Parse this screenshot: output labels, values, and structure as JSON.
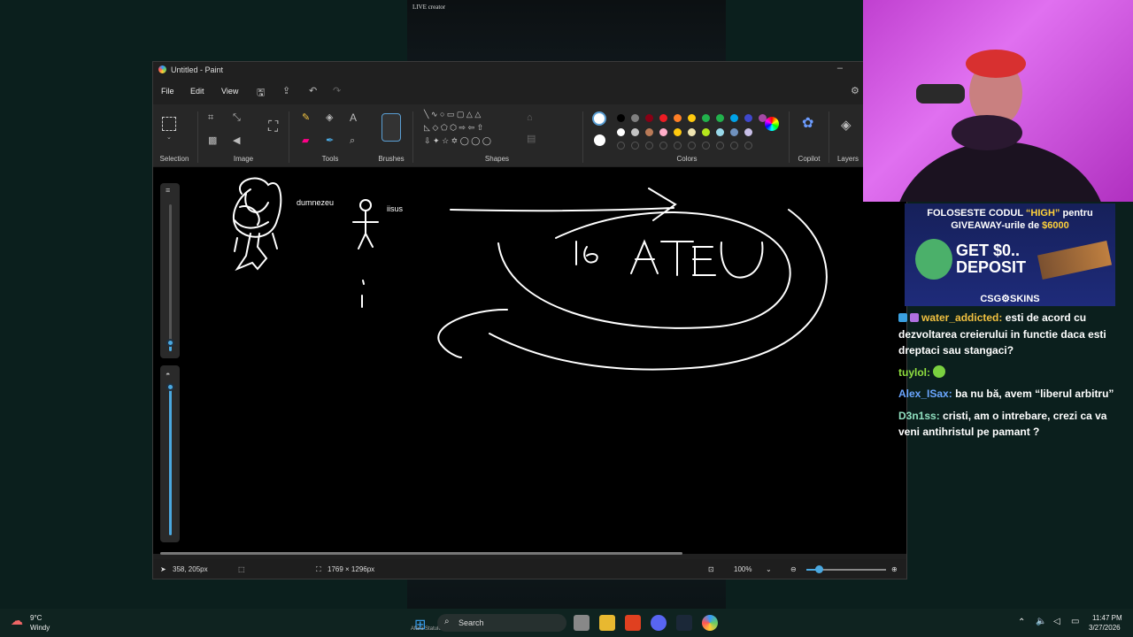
{
  "stream": {
    "live_label": "LIVE creator"
  },
  "paint": {
    "window_title": "Untitled - Paint",
    "menu": {
      "file": "File",
      "edit": "Edit",
      "view": "View"
    },
    "ribbon": {
      "groups": {
        "selection": "Selection",
        "image": "Image",
        "tools": "Tools",
        "brushes": "Brushes",
        "shapes": "Shapes",
        "colors": "Colors",
        "copilot": "Copilot",
        "layers": "Layers"
      },
      "text_tool": "A",
      "palette_row1": [
        "#000000",
        "#7f7f7f",
        "#880015",
        "#ed1c24",
        "#ff7f27",
        "#ffc90e",
        "#22b14c",
        "#22b14c",
        "#00a2e8",
        "#3f48cc",
        "#a349a4"
      ],
      "palette_row2": [
        "#ffffff",
        "#c3c3c3",
        "#b97a57",
        "#ffaec9",
        "#ffc90e",
        "#efe4b0",
        "#b5e61d",
        "#99d9ea",
        "#7092be",
        "#c8bfe7"
      ]
    },
    "canvas": {
      "label_dumnezeu": "dumnezeu",
      "label_iisus": "iisus",
      "ink": "#ffffff",
      "background": "#000000"
    },
    "status": {
      "cursor_pos": "358, 205px",
      "canvas_size": "1769 × 1296px",
      "zoom": "100%"
    }
  },
  "stream_overlay": {
    "banner": {
      "line1_a": "FOLOSESTE CODUL ",
      "line1_b": "“HIGH”",
      "line1_c": " pentru",
      "line2_a": "GIVEAWAY-urile de ",
      "line2_b": "$6000",
      "promo": "GET $0.. DEPOSIT",
      "brand": "CSG⚙SKINS"
    },
    "chat": [
      {
        "user": "water_addicted",
        "text": "esti de acord cu dezvoltarea creierului in functie daca esti dreptaci sau stangaci?"
      },
      {
        "user": "tuylol",
        "text": ""
      },
      {
        "user": "Alex_ISax",
        "text": "ba nu bă, avem “liberul arbitru”"
      },
      {
        "user": "D3n1ss",
        "text": "cristi, am o intrebare, crezi ca va veni antihristul pe pamant ?"
      }
    ]
  },
  "taskbar": {
    "weather_temp": "9°C",
    "weather_desc": "Windy",
    "search": "Search",
    "time": "11:47 PM",
    "date": "3/27/2026",
    "tray_label": "Afara Statului Romania"
  }
}
